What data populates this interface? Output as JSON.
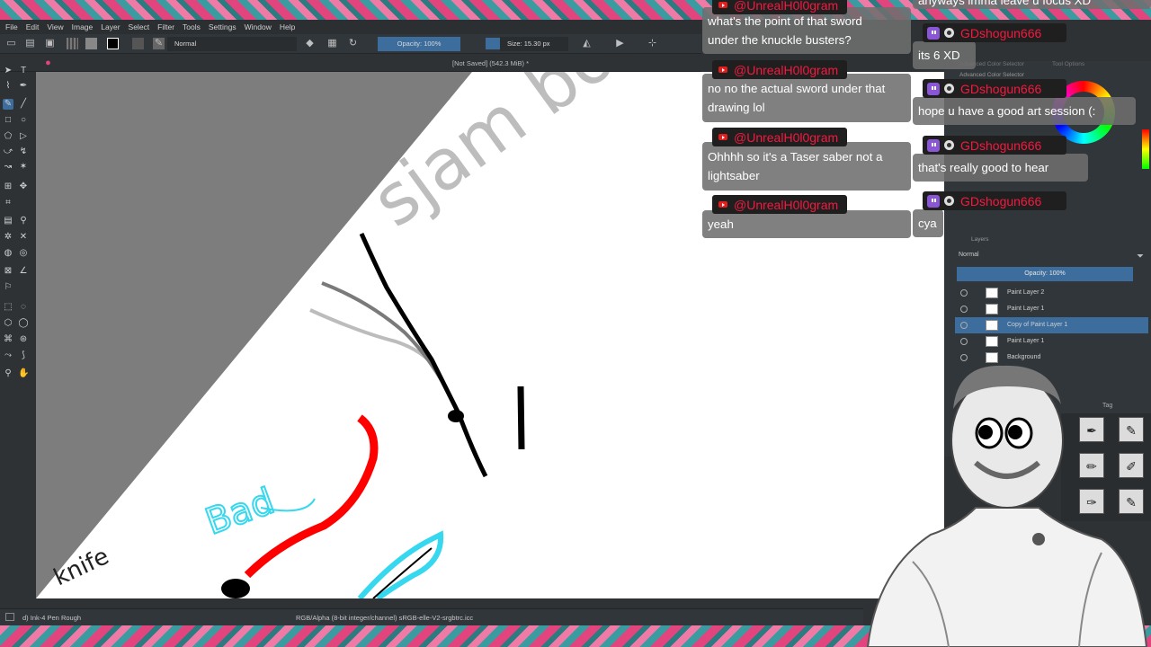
{
  "app": {
    "menu": [
      "File",
      "Edit",
      "View",
      "Image",
      "Layer",
      "Select",
      "Filter",
      "Tools",
      "Settings",
      "Window",
      "Help"
    ],
    "toolbar": {
      "blend_mode": "Normal",
      "opacity": "Opacity: 100%",
      "size": "Size: 15.30 px"
    },
    "document_title": "[Not Saved] (542.3 MiB) *",
    "status": {
      "brush": "d) Ink-4 Pen Rough",
      "color_space": "RGB/Alpha (8-bit integer/channel)  sRGB-elle-V2-srgbtrc.icc"
    }
  },
  "canvas": {
    "handwriting_top": "sjam bo",
    "handwriting_blue": "Bad",
    "handwriting_knife": "knife"
  },
  "right_panel": {
    "color_tabs": [
      "Advanced Color Selector",
      "Tool Options"
    ],
    "color_title": "Advanced Color Selector",
    "layers_title": "Layers",
    "blend_mode": "Normal",
    "opacity": "Opacity:  100%",
    "layers": [
      {
        "name": "Paint Layer 2",
        "selected": false
      },
      {
        "name": "Paint Layer 1",
        "selected": false
      },
      {
        "name": "Copy of Paint Layer 1",
        "selected": true
      },
      {
        "name": "Paint Layer 1",
        "selected": false
      },
      {
        "name": "Background",
        "selected": false
      }
    ],
    "brush_tag": "Tag"
  },
  "chat_left": [
    {
      "platform": "youtube",
      "user": "@UnrealH0l0gram",
      "lines": [
        "what's the point of that sword",
        "under the knuckle busters?"
      ]
    },
    {
      "platform": "youtube",
      "user": "@UnrealH0l0gram",
      "lines": [
        "no no the actual sword under that",
        "drawing lol"
      ]
    },
    {
      "platform": "youtube",
      "user": "@UnrealH0l0gram",
      "lines": [
        "Ohhhh so it's a Taser saber not a",
        "lightsaber"
      ]
    },
    {
      "platform": "youtube",
      "user": "@UnrealH0l0gram",
      "lines": [
        "yeah"
      ]
    }
  ],
  "chat_right": [
    {
      "platform": "none",
      "user": "",
      "lines": [
        "anyways imma leave u focus XD"
      ]
    },
    {
      "platform": "twitch",
      "user": "GDshogun666",
      "lines": [
        "its 6 XD"
      ]
    },
    {
      "platform": "twitch",
      "user": "GDshogun666",
      "lines": [
        "hope u have a good art session (:"
      ]
    },
    {
      "platform": "twitch",
      "user": "GDshogun666",
      "lines": [
        "that's really good to hear"
      ]
    },
    {
      "platform": "twitch",
      "user": "GDshogun666",
      "lines": [
        "cya"
      ]
    }
  ],
  "colors": {
    "ui_dark": "#2e3235",
    "panel": "#31363a",
    "selection": "#3d6d9c",
    "chat_bubble": "#6e6e6e",
    "chat_name_red": "#f5193f",
    "youtube_red": "#e51d1d",
    "twitch_purple": "#8a56d6",
    "stroke_red": "#ff0000",
    "stroke_cyan": "#35d8ee"
  },
  "icons": {
    "new_file": "new-file-icon",
    "open": "open-icon",
    "save": "save-icon",
    "eraser": "eraser-icon",
    "reload": "reload-icon",
    "mirror": "mirror-icon",
    "crop": "crop-icon"
  }
}
